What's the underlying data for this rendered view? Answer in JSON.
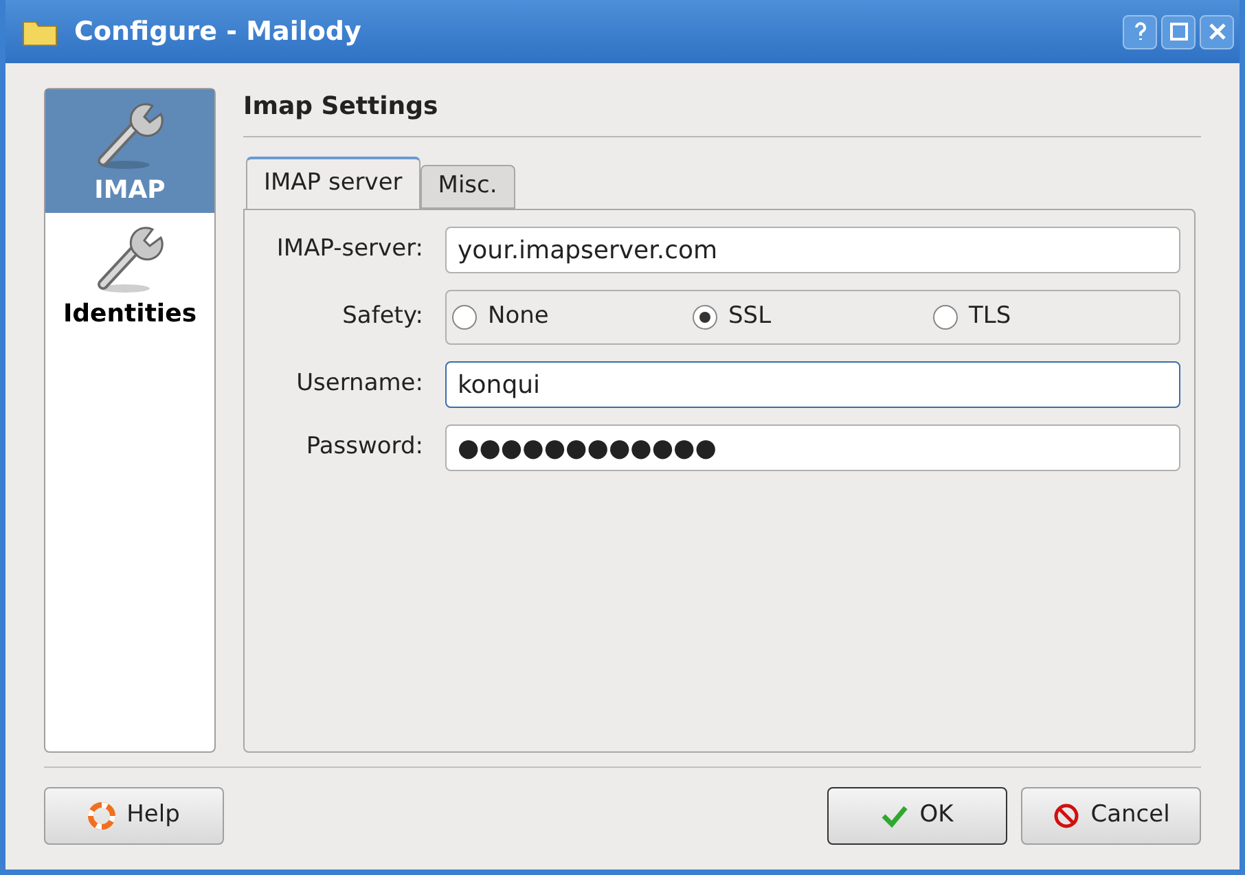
{
  "window": {
    "title": "Configure - Mailody"
  },
  "sidebar": {
    "items": [
      {
        "label": "IMAP",
        "selected": true
      },
      {
        "label": "Identities",
        "selected": false
      }
    ]
  },
  "page_title": "Imap Settings",
  "tabs": [
    {
      "label": "IMAP server",
      "selected": true
    },
    {
      "label": "Misc.",
      "selected": false
    }
  ],
  "form": {
    "server": {
      "label": "IMAP-server:",
      "value": "your.imapserver.com"
    },
    "safety": {
      "label": "Safety:",
      "options": [
        {
          "label": "None",
          "selected": false
        },
        {
          "label": "SSL",
          "selected": true
        },
        {
          "label": "TLS",
          "selected": false
        }
      ]
    },
    "username": {
      "label": "Username:",
      "value": "konqui",
      "focused": true
    },
    "password": {
      "label": "Password:",
      "value": "●●●●●●●●●●●●"
    }
  },
  "buttons": [
    {
      "label": "Help",
      "kind": "help",
      "default": false
    },
    {
      "label": "OK",
      "kind": "ok",
      "default": true
    },
    {
      "label": "Cancel",
      "kind": "cancel",
      "default": false
    }
  ]
}
